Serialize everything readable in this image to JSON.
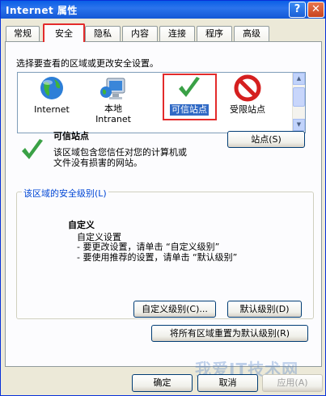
{
  "window": {
    "title": "Internet 属性",
    "help": "?",
    "close": "✕"
  },
  "tabs": [
    {
      "label": "常规"
    },
    {
      "label": "安全"
    },
    {
      "label": "隐私"
    },
    {
      "label": "内容"
    },
    {
      "label": "连接"
    },
    {
      "label": "程序"
    },
    {
      "label": "高级"
    }
  ],
  "active_tab": "安全",
  "security": {
    "instruction": "选择要查看的区域或更改安全设置。",
    "zones": [
      {
        "label": "Internet",
        "icon": "globe-icon"
      },
      {
        "label1": "本地",
        "label2": "Intranet",
        "icon": "monitor-globe-icon"
      },
      {
        "label": "可信站点",
        "icon": "green-check-icon",
        "selected": true
      },
      {
        "label": "受限站点",
        "icon": "red-no-icon"
      }
    ],
    "zone_name": "可信站点",
    "zone_desc_1": "该区域包含您信任对您的计算机或",
    "zone_desc_2": "文件没有损害的网站。",
    "sites_button": "站点(S)",
    "group_title": "该区域的安全级别(L)",
    "level_title": "自定义",
    "level_line1": "自定义设置",
    "level_line2": "- 要更改设置，请单击 “自定义级别”",
    "level_line3": "- 要使用推荐的设置，请单击 “默认级别”",
    "custom_level_button": "自定义级别(C)...",
    "default_level_button": "默认级别(D)",
    "reset_all_button": "将所有区域重置为默认级别(R)"
  },
  "footer": {
    "ok": "确定",
    "cancel": "取消",
    "apply": "应用(A)"
  },
  "watermark": "我爱IT技术网",
  "colors": {
    "titlebar": "#0a5fe6",
    "highlight": "#e32b2b",
    "selection": "#316ac5",
    "group_title": "#0046d5"
  }
}
